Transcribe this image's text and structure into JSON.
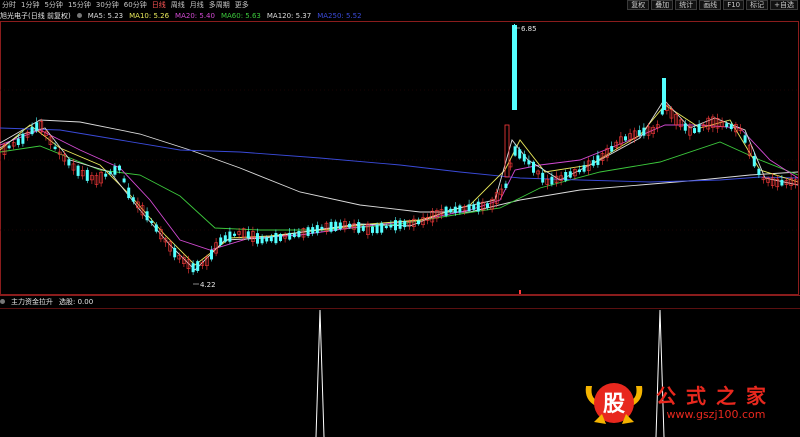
{
  "toolbar": {
    "periods": [
      "分时",
      "1分钟",
      "5分钟",
      "15分钟",
      "30分钟",
      "60分钟",
      "日线",
      "周线",
      "月线",
      "多周期",
      "更多"
    ],
    "active_period": "日线",
    "right_buttons": [
      "复权",
      "叠加",
      "统计",
      "画线",
      "F10",
      "标记",
      "+自选"
    ]
  },
  "main_panel": {
    "title": "旭光电子(日线 前复权)",
    "ma": [
      {
        "label": "MA5: 5.23",
        "color": "#dcdcdc"
      },
      {
        "label": "MA10: 5.26",
        "color": "#e8e85a"
      },
      {
        "label": "MA20: 5.40",
        "color": "#d24ad2"
      },
      {
        "label": "MA60: 5.63",
        "color": "#3cc83c"
      },
      {
        "label": "MA120: 5.37",
        "color": "#dcdcdc"
      },
      {
        "label": "MA250: 5.52",
        "color": "#3a4ad8"
      }
    ],
    "high_label": "6.85",
    "low_label": "4.22"
  },
  "indicator_panel": {
    "title": "主力资金拉升",
    "value_label": "选股: 0.00"
  },
  "watermark": {
    "logo_char": "股",
    "title": "公式之家",
    "url": "www.gszj100.com"
  },
  "colors": {
    "up": "#ff3c3c",
    "down": "#54ffff",
    "border": "#8a1c1c",
    "grid": "#6a1010",
    "signal": "#ffffff"
  },
  "chart_data": [
    {
      "type": "candlestick",
      "series": [
        {
          "name": "MA5",
          "color": "#dcdcdc"
        },
        {
          "name": "MA10",
          "color": "#e8e85a"
        },
        {
          "name": "MA20",
          "color": "#d24ad2"
        },
        {
          "name": "MA60",
          "color": "#3cc83c"
        },
        {
          "name": "MA120",
          "color": "#dcdcdc"
        },
        {
          "name": "MA250",
          "color": "#3a4ad8"
        }
      ],
      "annotations": [
        "6.85",
        "4.22"
      ]
    },
    {
      "type": "line",
      "title": "主力资金拉升",
      "series": [
        {
          "name": "选股",
          "spikes_at_fraction": [
            0.4,
            0.825
          ]
        }
      ]
    }
  ]
}
